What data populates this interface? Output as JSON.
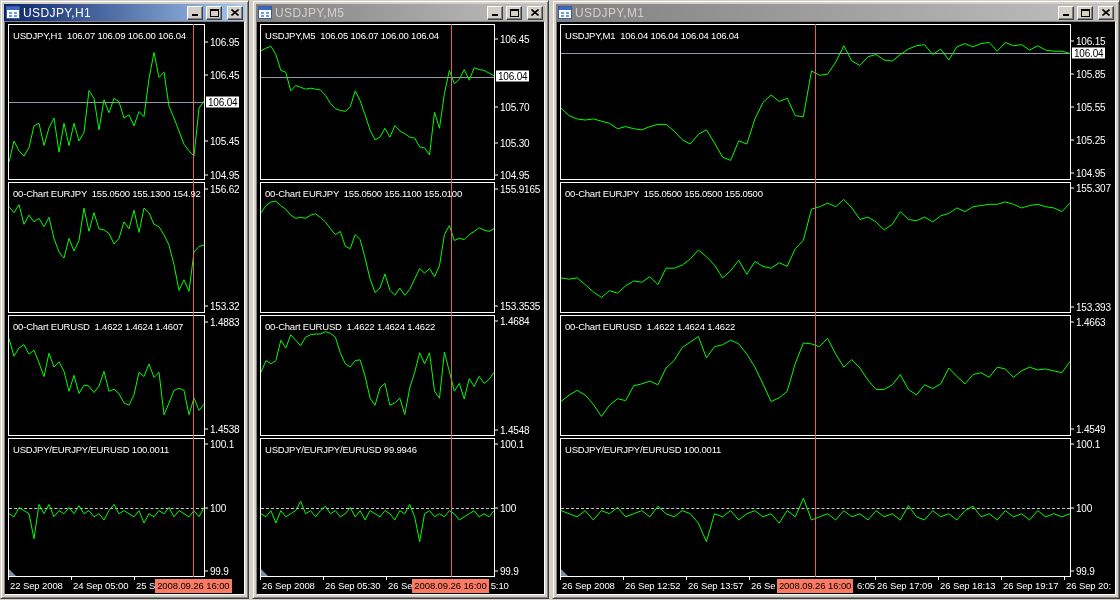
{
  "windows": [
    {
      "title": "USDJPY,H1",
      "active": true,
      "panels": [
        {
          "legend": "USDJPY,H1  106.07 106.09 106.00 106.04",
          "chart_data": {
            "type": "line",
            "ylim": [
              104.87,
              107.22
            ],
            "yticks": [
              106.95,
              106.45,
              105.45,
              104.95
            ],
            "values": [
              105.13,
              105.45,
              105.3,
              105.22,
              105.35,
              105.68,
              105.72,
              105.38,
              105.65,
              105.8,
              105.28,
              105.72,
              105.38,
              105.72,
              105.45,
              105.58,
              106.22,
              106.1,
              105.62,
              106.08,
              105.88,
              106.1,
              106.05,
              105.8,
              105.85,
              105.68,
              105.9,
              105.82,
              106.4,
              106.8,
              106.42,
              106.5,
              105.98,
              105.8,
              105.6,
              105.4,
              105.3,
              105.22,
              105.95,
              106.06
            ],
            "ref_lines": [
              {
                "axis": "y",
                "value": 106.04,
                "label": "106.04"
              }
            ]
          }
        },
        {
          "legend": "00-Chart EURJPY  155.0500 155.1300 154.92",
          "chart_data": {
            "type": "line",
            "ylim": [
              153.135,
              156.805
            ],
            "yticks": [
              156.62,
              153.32
            ],
            "values": [
              156.13,
              155.96,
              156.19,
              155.63,
              155.89,
              155.7,
              155.8,
              155.56,
              155.83,
              155.23,
              154.84,
              154.67,
              155.23,
              154.87,
              155.17,
              156.09,
              155.43,
              155.96,
              155.5,
              155.47,
              155.37,
              155.07,
              155.23,
              155.7,
              155.5,
              156.03,
              155.4,
              156.09,
              155.96,
              155.63,
              155.56,
              155.33,
              155.04,
              154.48,
              153.75,
              154.05,
              153.72,
              154.84,
              155.0,
              155.04
            ]
          }
        },
        {
          "legend": "00-Chart EURUSD  1.4622 1.4624 1.4607",
          "chart_data": {
            "type": "line",
            "ylim": [
              1.4517,
              1.4904
            ],
            "yticks": [
              1.4883,
              1.4538
            ],
            "values": [
              1.4831,
              1.4773,
              1.48,
              1.4811,
              1.478,
              1.4793,
              1.4752,
              1.4707,
              1.4783,
              1.4738,
              1.4755,
              1.4724,
              1.4659,
              1.4711,
              1.4652,
              1.4679,
              1.4676,
              1.4655,
              1.4676,
              1.4724,
              1.4659,
              1.4666,
              1.4652,
              1.4621,
              1.4614,
              1.4648,
              1.4721,
              1.4707,
              1.4748,
              1.4704,
              1.4721,
              1.4583,
              1.4621,
              1.4662,
              1.4669,
              1.4662,
              1.4583,
              1.4638,
              1.4597,
              1.4617
            ]
          }
        },
        {
          "legend": "USDJPY/EURJPY/EURUSD 100.0011",
          "chart_data": {
            "type": "line",
            "ylim": [
              99.89,
              100.11
            ],
            "yticks": [
              100.1,
              100,
              99.9
            ],
            "values": [
              99.99,
              99.985,
              100.0,
              99.995,
              99.99,
              99.95,
              100.005,
              99.99,
              100.005,
              99.985,
              99.995,
              99.99,
              100.0,
              99.99,
              100.003,
              99.99,
              99.995,
              99.985,
              99.99,
              99.98,
              99.995,
              100.005,
              99.99,
              99.995,
              99.99,
              99.985,
              99.995,
              99.975,
              99.99,
              99.985,
              99.995,
              99.99,
              100.0,
              99.985,
              99.995,
              99.99,
              99.985,
              99.995,
              99.985,
              100.0
            ],
            "ref_lines": [
              {
                "axis": "y",
                "value": 100
              }
            ]
          }
        }
      ],
      "time_axis": [
        {
          "kind": "tick",
          "text": "22 Sep 2008"
        },
        {
          "kind": "tick",
          "text": "24 Sep 05:00"
        },
        {
          "kind": "cut",
          "text": "25 S"
        },
        {
          "kind": "cursor",
          "text": "2008.09.26 16:00"
        }
      ]
    },
    {
      "title": "USDJPY,M5",
      "active": false,
      "panels": [
        {
          "legend": "USDJPY,M5  106.05 106.07 106.00 106.04",
          "chart_data": {
            "type": "line",
            "ylim": [
              104.89,
              106.62
            ],
            "yticks": [
              106.45,
              {
                "value": 105.7,
                "label": "105.70"
              },
              {
                "value": 105.3,
                "label": "105.30"
              },
              104.95
            ],
            "values": [
              106.33,
              106.36,
              106.38,
              106.29,
              106.11,
              106.09,
              105.88,
              105.94,
              105.92,
              105.9,
              105.91,
              105.9,
              105.89,
              105.83,
              105.74,
              105.68,
              105.66,
              105.65,
              105.7,
              105.88,
              105.77,
              105.61,
              105.44,
              105.33,
              105.36,
              105.46,
              105.36,
              105.49,
              105.43,
              105.4,
              105.36,
              105.35,
              105.25,
              105.24,
              105.16,
              105.64,
              105.46,
              105.85,
              106.11,
              105.96,
              106.01,
              106.12,
              106.0,
              106.14,
              106.12,
              106.11,
              106.08,
              106.05
            ],
            "ref_lines": [
              {
                "axis": "y",
                "value": 106.04,
                "label": "106.04"
              }
            ]
          }
        },
        {
          "legend": "00-Chart EURJPY  155.0500 155.1100 155.0100",
          "chart_data": {
            "type": "line",
            "ylim": [
              153.21,
              156.06
            ],
            "yticks": [
              155.9165,
              153.3535
            ],
            "values": [
              155.4,
              155.56,
              155.64,
              155.66,
              155.56,
              155.48,
              155.35,
              155.28,
              155.3,
              155.28,
              155.35,
              155.38,
              155.3,
              155.2,
              155.05,
              154.92,
              154.99,
              154.66,
              154.61,
              154.92,
              154.81,
              154.4,
              153.94,
              153.64,
              153.74,
              154.05,
              153.69,
              153.58,
              153.74,
              153.58,
              153.71,
              153.94,
              154.17,
              154.07,
              154.17,
              153.99,
              154.23,
              154.92,
              155.12,
              154.79,
              154.84,
              154.81,
              154.92,
              154.99,
              155.07,
              155.02,
              154.99,
              155.05
            ]
          }
        },
        {
          "legend": "00-Chart EURUSD  1.4622 1.4624 1.4622",
          "chart_data": {
            "type": "line",
            "ylim": [
              1.454,
              1.4692
            ],
            "yticks": [
              1.4684,
              1.4548
            ],
            "values": [
              1.462,
              1.4635,
              1.4631,
              1.4635,
              1.4661,
              1.4651,
              1.4668,
              1.4661,
              1.4654,
              1.4665,
              1.4668,
              1.4669,
              1.4669,
              1.4672,
              1.467,
              1.4665,
              1.4645,
              1.4631,
              1.4627,
              1.4635,
              1.4636,
              1.4615,
              1.4587,
              1.4578,
              1.46,
              1.4606,
              1.4578,
              1.4581,
              1.4587,
              1.4566,
              1.46,
              1.462,
              1.4645,
              1.4631,
              1.4645,
              1.4596,
              1.4587,
              1.4646,
              1.4621,
              1.4596,
              1.4606,
              1.4586,
              1.4612,
              1.4602,
              1.4615,
              1.4606,
              1.4611,
              1.462
            ]
          }
        },
        {
          "legend": "USDJPY/EURJPY/EURUSD 99.9946",
          "chart_data": {
            "type": "line",
            "ylim": [
              99.89,
              100.11
            ],
            "yticks": [
              100.1,
              100,
              99.9
            ],
            "values": [
              99.99,
              99.985,
              99.995,
              99.975,
              99.995,
              99.985,
              99.99,
              99.995,
              100.01,
              99.99,
              99.995,
              99.985,
              99.995,
              100.002,
              99.99,
              99.995,
              99.985,
              99.99,
              100.0,
              99.985,
              99.995,
              99.98,
              99.995,
              99.99,
              99.985,
              99.995,
              99.99,
              99.98,
              99.995,
              99.99,
              100.005,
              99.985,
              99.945,
              99.99,
              99.995,
              99.985,
              99.99,
              99.985,
              99.995,
              99.99,
              99.98,
              99.985,
              99.99,
              99.995,
              99.985,
              99.99,
              99.985,
              99.995
            ],
            "ref_lines": [
              {
                "axis": "y",
                "value": 100
              }
            ]
          }
        }
      ],
      "time_axis": [
        {
          "kind": "tick",
          "text": "26 Sep 2008"
        },
        {
          "kind": "tick",
          "text": "26 Sep 05:30"
        },
        {
          "kind": "cut",
          "text": "26 Se"
        },
        {
          "kind": "cursor",
          "text": "2008.09.26 16:00"
        },
        {
          "kind": "tail",
          "text": "5:10"
        }
      ]
    },
    {
      "title": "USDJPY,M1",
      "active": false,
      "panels": [
        {
          "legend": "USDJPY,M1  106.04 106.04 106.04 106.04",
          "chart_data": {
            "type": "line",
            "ylim": [
              104.89,
              106.3
            ],
            "yticks": [
              106.15,
              105.85,
              105.55,
              105.25,
              104.95
            ],
            "values": [
              105.54,
              105.47,
              105.44,
              105.43,
              105.44,
              105.42,
              105.4,
              105.35,
              105.37,
              105.35,
              105.34,
              105.37,
              105.39,
              105.39,
              105.33,
              105.25,
              105.21,
              105.3,
              105.34,
              105.22,
              105.09,
              105.06,
              105.24,
              105.21,
              105.44,
              105.59,
              105.66,
              105.6,
              105.63,
              105.47,
              105.46,
              105.88,
              105.84,
              105.85,
              105.96,
              106.11,
              105.97,
              105.93,
              106.01,
              106.03,
              105.98,
              105.97,
              106.03,
              106.08,
              106.11,
              106.12,
              106.03,
              106.08,
              105.98,
              106.1,
              106.13,
              106.1,
              106.13,
              106.14,
              106.06,
              106.14,
              106.11,
              106.12,
              106.07,
              106.11,
              106.07,
              106.06,
              106.06,
              106.04
            ],
            "ref_lines": [
              {
                "axis": "y",
                "value": 106.04,
                "label": "106.04"
              }
            ]
          }
        },
        {
          "legend": "00-Chart EURJPY  155.0500 155.0500 155.0500",
          "chart_data": {
            "type": "line",
            "ylim": [
              153.29,
              155.41
            ],
            "yticks": [
              155.307,
              153.393
            ],
            "values": [
              153.85,
              153.83,
              153.85,
              153.74,
              153.62,
              153.53,
              153.64,
              153.6,
              153.72,
              153.8,
              153.78,
              153.87,
              153.74,
              154.01,
              154.01,
              154.06,
              154.16,
              154.31,
              154.2,
              154.06,
              153.85,
              153.97,
              154.14,
              153.91,
              154.12,
              154.04,
              154.01,
              154.1,
              154.04,
              154.33,
              154.47,
              154.98,
              155.02,
              155.08,
              155.02,
              155.14,
              155.0,
              154.81,
              154.85,
              154.77,
              154.64,
              154.73,
              154.94,
              154.81,
              154.79,
              154.85,
              154.77,
              154.87,
              154.91,
              155.0,
              154.94,
              155.02,
              155.04,
              155.06,
              155.06,
              155.1,
              155.06,
              155.0,
              155.04,
              155.06,
              155.02,
              155.0,
              154.94,
              155.08
            ]
          }
        },
        {
          "legend": "00-Chart EURUSD  1.4622 1.4624 1.4622",
          "chart_data": {
            "type": "line",
            "ylim": [
              1.4542,
              1.467
            ],
            "yticks": [
              1.4663,
              1.4549
            ],
            "values": [
              1.4578,
              1.4585,
              1.459,
              1.4585,
              1.4575,
              1.4562,
              1.4574,
              1.4581,
              1.4579,
              1.4595,
              1.4597,
              1.46,
              1.4596,
              1.4614,
              1.4622,
              1.4636,
              1.4642,
              1.4648,
              1.4625,
              1.4637,
              1.4639,
              1.4644,
              1.464,
              1.4629,
              1.4615,
              1.4597,
              1.4578,
              1.4582,
              1.4589,
              1.4619,
              1.4641,
              1.464,
              1.4637,
              1.4646,
              1.4629,
              1.4615,
              1.4623,
              1.4614,
              1.4601,
              1.4591,
              1.4591,
              1.4596,
              1.4607,
              1.4591,
              1.4585,
              1.4596,
              1.4592,
              1.4597,
              1.4614,
              1.4605,
              1.4597,
              1.4607,
              1.4609,
              1.4604,
              1.4615,
              1.4613,
              1.4604,
              1.4611,
              1.4615,
              1.4612,
              1.4613,
              1.4611,
              1.4609,
              1.4621
            ]
          }
        },
        {
          "legend": "USDJPY/EURJPY/EURUSD 100.0011",
          "chart_data": {
            "type": "line",
            "ylim": [
              99.89,
              100.11
            ],
            "yticks": [
              100.1,
              100,
              99.9
            ],
            "values": [
              99.995,
              99.99,
              99.985,
              99.995,
              99.98,
              99.995,
              99.99,
              100.0,
              99.985,
              99.99,
              99.995,
              99.985,
              100.002,
              99.99,
              99.985,
              99.995,
              99.99,
              99.975,
              99.945,
              99.99,
              99.985,
              99.995,
              99.98,
              99.99,
              99.995,
              99.985,
              99.99,
              99.975,
              99.995,
              99.985,
              100.015,
              99.98,
              99.985,
              99.99,
              99.98,
              99.995,
              99.985,
              99.99,
              99.98,
              99.995,
              99.985,
              99.99,
              99.98,
              100.003,
              99.985,
              99.98,
              99.995,
              99.985,
              99.99,
              99.98,
              99.995,
              100.002,
              99.985,
              99.99,
              99.98,
              99.995,
              99.985,
              99.99,
              99.98,
              99.995,
              99.985,
              99.99,
              99.985,
              99.99
            ],
            "ref_lines": [
              {
                "axis": "y",
                "value": 100
              }
            ]
          }
        }
      ],
      "time_axis": [
        {
          "kind": "tick",
          "text": "26 Sep 2008"
        },
        {
          "kind": "tick",
          "text": "26 Sep 12:52"
        },
        {
          "kind": "tick",
          "text": "26 Sep 13:57"
        },
        {
          "kind": "cut",
          "text": "26 Se"
        },
        {
          "kind": "cursor",
          "text": "2008.09.26 16:00"
        },
        {
          "kind": "tail",
          "text": "6:05"
        },
        {
          "kind": "tick",
          "text": "26 Sep 17:09"
        },
        {
          "kind": "tick",
          "text": "26 Sep 18:13"
        },
        {
          "kind": "tick",
          "text": "26 Sep 19:17"
        },
        {
          "kind": "tick",
          "text": "26 Sep 20:"
        }
      ]
    }
  ]
}
